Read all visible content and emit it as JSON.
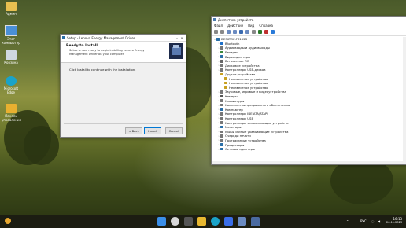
{
  "desktop": {
    "icons": [
      {
        "label": "Админ",
        "icon": "user-folder-icon"
      },
      {
        "label": "Этот компьютер",
        "icon": "computer-icon"
      },
      {
        "label": "Корзина",
        "icon": "recycle-bin-icon"
      },
      {
        "label": "Microsoft Edge",
        "icon": "edge-icon"
      },
      {
        "label": "Панель управления",
        "icon": "control-panel-icon"
      }
    ]
  },
  "setup": {
    "title": "Setup - Lenovo Energy Management Driver",
    "heading": "Ready to Install",
    "subheading": "Setup is now ready to begin installing Lenovo Energy Management Driver on your computer.",
    "body": "Click Install to continue with the installation.",
    "back": "< Back",
    "install": "Install",
    "cancel": "Cancel"
  },
  "devmgr": {
    "title": "Диспетчер устройств",
    "menu": [
      "Файл",
      "Действие",
      "Вид",
      "Справка"
    ],
    "root": "DESKTOP-F3192S",
    "items": [
      {
        "label": "Bluetooth",
        "expanded": false,
        "color": "#1e70c8"
      },
      {
        "label": "Аудиовходы и аудиовыходы",
        "expanded": false,
        "color": "#777"
      },
      {
        "label": "Батареи",
        "expanded": false,
        "color": "#3a8a3a"
      },
      {
        "label": "Видеоадаптеры",
        "expanded": false,
        "color": "#2a6fa8"
      },
      {
        "label": "Встроенное ПО",
        "expanded": false,
        "color": "#666"
      },
      {
        "label": "Дисковые устройства",
        "expanded": false,
        "color": "#777"
      },
      {
        "label": "Контроллеры USB-дисков",
        "expanded": false,
        "color": "#777"
      },
      {
        "label": "Другие устройства",
        "expanded": true,
        "color": "#c8a020"
      },
      {
        "label": "Неизвестное устройство",
        "child": true,
        "color": "#c8a020"
      },
      {
        "label": "Неизвестное устройство",
        "child": true,
        "color": "#c8a020"
      },
      {
        "label": "Неизвестное устройство",
        "child": true,
        "color": "#c8a020"
      },
      {
        "label": "Звуковые, игровые и видеоустройства",
        "expanded": false,
        "color": "#777"
      },
      {
        "label": "Камеры",
        "expanded": false,
        "color": "#555"
      },
      {
        "label": "Клавиатуры",
        "expanded": false,
        "color": "#777"
      },
      {
        "label": "Компоненты программного обеспечения",
        "expanded": false,
        "color": "#777"
      },
      {
        "label": "Компьютер",
        "expanded": false,
        "color": "#2a6fa8"
      },
      {
        "label": "Контроллеры IDE ATA/ATAPI",
        "expanded": false,
        "color": "#777"
      },
      {
        "label": "Контроллеры USB",
        "expanded": false,
        "color": "#777"
      },
      {
        "label": "Контроллеры запоминающих устройств",
        "expanded": false,
        "color": "#777"
      },
      {
        "label": "Мониторы",
        "expanded": false,
        "color": "#2a6fa8"
      },
      {
        "label": "Мыши и иные указывающие устройства",
        "expanded": false,
        "color": "#777"
      },
      {
        "label": "Очереди печати",
        "expanded": false,
        "color": "#777"
      },
      {
        "label": "Программные устройства",
        "expanded": false,
        "color": "#777"
      },
      {
        "label": "Процессоры",
        "expanded": false,
        "color": "#2a6fa8"
      },
      {
        "label": "Сетевые адаптеры",
        "expanded": false,
        "color": "#2a6fa8"
      }
    ]
  },
  "taskbar": {
    "lang": "РУС",
    "time": "16:13",
    "date": "26.11.2023",
    "colors": {
      "start": "#3a8ee8",
      "search": "#d8d8d8",
      "explorer": "#e8b830",
      "edge": "#1aa3c8",
      "store": "#3a6ee8"
    }
  }
}
